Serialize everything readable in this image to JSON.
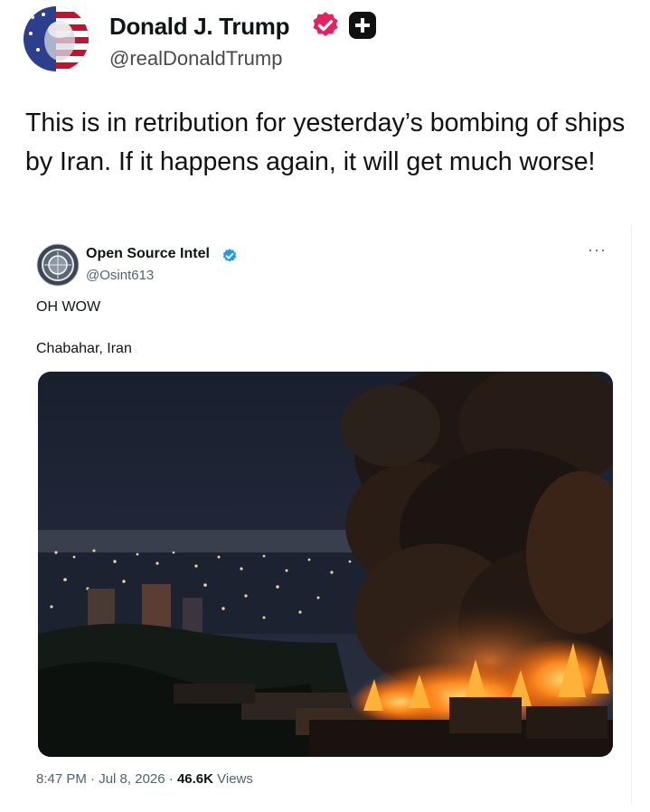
{
  "post": {
    "author_name": "Donald J. Trump",
    "author_handle": "@realDonaldTrump",
    "text": "This is in retribution for yesterday’s bombing of ships by Iran. If it happens again, it will get much worse!",
    "verified_badge_color": "#e0245e"
  },
  "quoted": {
    "author_name": "Open Source Intel",
    "author_handle": "@Osint613",
    "more_label": "···",
    "line1": "OH WOW",
    "line2": "Chabahar, Iran",
    "footer": {
      "time": "8:47 PM",
      "sep1": " · ",
      "date": "Jul 8, 2026",
      "sep2": " · ",
      "views_count": "46.6K",
      "views_label": " Views"
    },
    "verified_badge_color": "#1d9bf0"
  },
  "icons": {
    "verified": "verified-badge-icon",
    "plus": "plus-square-icon",
    "more": "more-dots-icon"
  }
}
